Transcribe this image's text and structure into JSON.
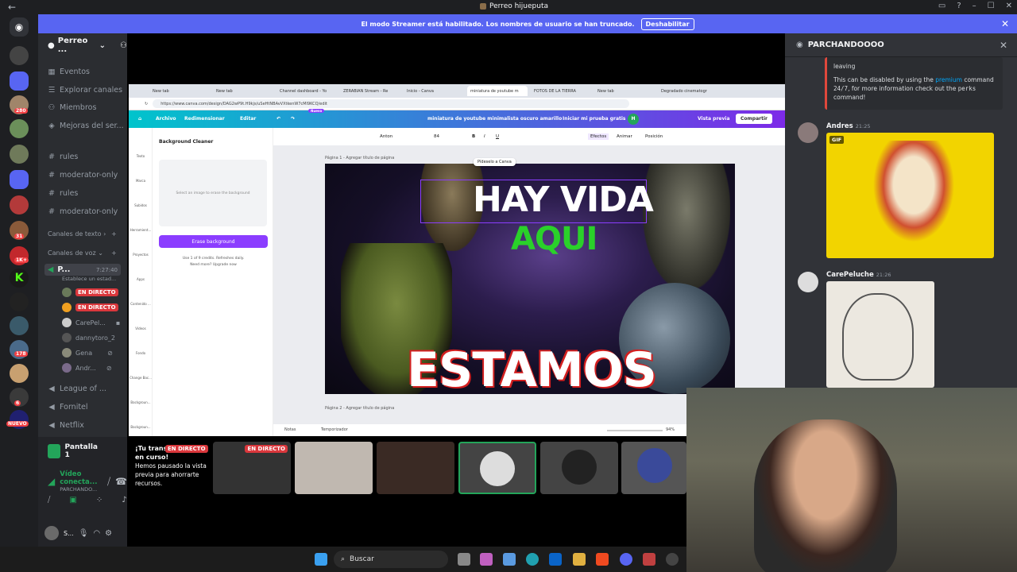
{
  "window": {
    "title": "Perreo hijueputa"
  },
  "banner": {
    "message": "El modo Streamer está habilitado. Los nombres de usuario se han truncado.",
    "button": "Deshabilitar"
  },
  "rail_badges": [
    "280",
    "31",
    "1K+",
    "178",
    "6",
    "NUEVO"
  ],
  "server": {
    "name": "Perreo ..."
  },
  "channels": {
    "events": "Eventos",
    "explore": "Explorar canales",
    "members": "Miembros",
    "boosts": "Mejoras del ser...",
    "text": [
      "rules",
      "moderator-only",
      "rules",
      "moderator-only"
    ],
    "cat_text": "Canales de texto",
    "cat_voice": "Canales de voz",
    "voice_channel": "P...",
    "voice_time": "7:27:40",
    "voice_status": "Establece un estad...",
    "voice_users": [
      {
        "name": "",
        "live": "EN DIRECTO"
      },
      {
        "name": "",
        "live": "EN DIRECTO"
      },
      {
        "name": "CarePel..."
      },
      {
        "name": "dannytoro_2"
      },
      {
        "name": "Gena"
      },
      {
        "name": "Andr..."
      }
    ],
    "other_voice": [
      "League of ...",
      "Fornitel",
      "Netflix"
    ]
  },
  "voice_panel": {
    "screen_label": "Pantalla 1",
    "status": "Vídeo conecta...",
    "channel": "PARCHANDO...",
    "user": "S..."
  },
  "browser": {
    "tabs": [
      "New tab",
      "New tab",
      "Channel dashboard - Yo",
      "ZERABIAN Stream - Re",
      "Inicio - Canva",
      "miniatura de youtube m",
      "FOTOS DE LA TIERRA",
      "New tab",
      "Degradado cinematogr"
    ],
    "url": "https://www.canva.com/design/DAG2wP9t.H9kjs/uSeHtNBAvVXtkenW7cMl9KCQ/edit",
    "canva_menu": [
      "Archivo",
      "Redimensionar",
      "Editar"
    ],
    "new_badge": "Nuevo",
    "doc_title": "miniatura de youtube minimalista oscuro amarillo",
    "trial": "Iniciar mi prueba gratis",
    "preview": "Vista previa",
    "share": "Compartir",
    "side_tools": [
      "Texto",
      "Marca",
      "Subidos",
      "Herramient...",
      "Proyectos",
      "Apps",
      "Contenido ...",
      "Vídeos",
      "Fondo",
      "Change Bac...",
      "Backgroun...",
      "Backgroun..."
    ],
    "panel_title": "Background Cleaner",
    "drop_text": "Select an image to erase the background",
    "erase_button": "Erase background",
    "credits": "Use 1 of 9 credits. Refreshes daily.",
    "need_more": "Need more? Upgrade now",
    "font": "Anton",
    "font_size": "84",
    "toolbar_right": [
      "Efectos",
      "Animar",
      "Posición"
    ],
    "page1": "Página 1 - Agregar título de página",
    "page2": "Página 2 - Agregar título de página",
    "ask_canva": "Pídeselo a Canva",
    "headline_1": "HAY VIDA",
    "headline_2": "AQUI",
    "headline_3": "ESTAMOS SOLOS?",
    "notes": "Notas",
    "timer": "Temporizador",
    "zoom": "94%"
  },
  "chat": {
    "title": "PARCHANDOOOO",
    "embed_leaving": "leaving",
    "embed_text_1": "This can be disabled by using the",
    "embed_premium": "premium",
    "embed_text_2": "command",
    "embed_247": "24/7",
    "embed_text_3": ", for more information check out the",
    "embed_perks": "perks",
    "embed_text_4": "command!",
    "msg1_user": "Andres",
    "msg1_time": "21:25",
    "gif_tag": "GIF",
    "msg2_user": "CarePeluche",
    "msg2_time": "21:26"
  },
  "strip": {
    "paused_title": "¡Tu transmisión está en curso!",
    "paused_body": "Hemos pausado la vista previa para ahorrarte recursos.",
    "live": "EN DIRECTO"
  },
  "taskbar": {
    "search": "Buscar"
  }
}
